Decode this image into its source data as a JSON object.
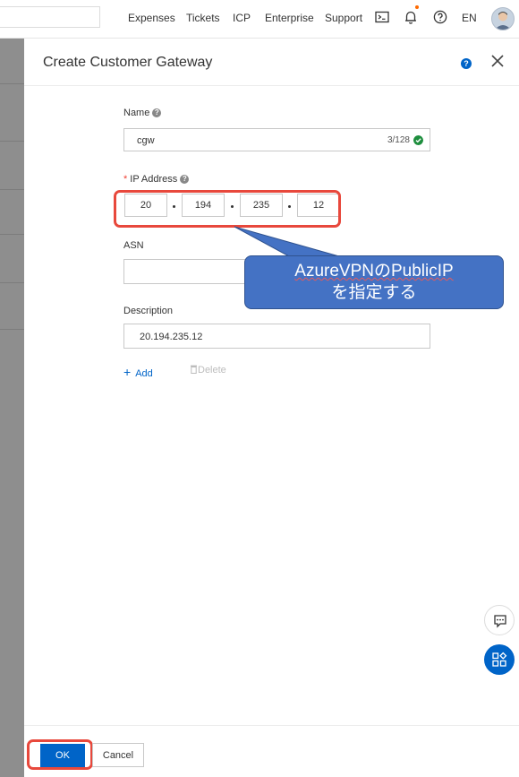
{
  "topbar": {
    "links": [
      "Expenses",
      "Tickets",
      "ICP",
      "Enterprise",
      "Support"
    ],
    "language": "EN"
  },
  "panel": {
    "title": "Create Customer Gateway"
  },
  "form": {
    "name": {
      "label": "Name",
      "value": "cgw",
      "counter": "3/128"
    },
    "ip": {
      "required_mark": "*",
      "label": "IP Address",
      "octets": [
        "20",
        "194",
        "235",
        "12"
      ]
    },
    "asn": {
      "label": "ASN",
      "value": ""
    },
    "description": {
      "label": "Description",
      "value": "20.194.235.12"
    },
    "add_label": "Add",
    "delete_label": "Delete"
  },
  "callout": {
    "line1": "AzureVPNのPublicIP",
    "line2": "を指定する"
  },
  "footer": {
    "ok_label": "OK",
    "cancel_label": "Cancel"
  },
  "colors": {
    "primary": "#0064c8",
    "highlight_red": "#e8483c",
    "callout_blue": "#4472c4",
    "success_green": "#1e8e3e",
    "notification_orange": "#ff6a00"
  },
  "icons": [
    "terminal-icon",
    "bell-icon",
    "help-circle-icon",
    "question-icon",
    "close-icon",
    "check-circle-icon",
    "plus-icon",
    "trash-icon",
    "chat-icon",
    "apps-icon"
  ]
}
